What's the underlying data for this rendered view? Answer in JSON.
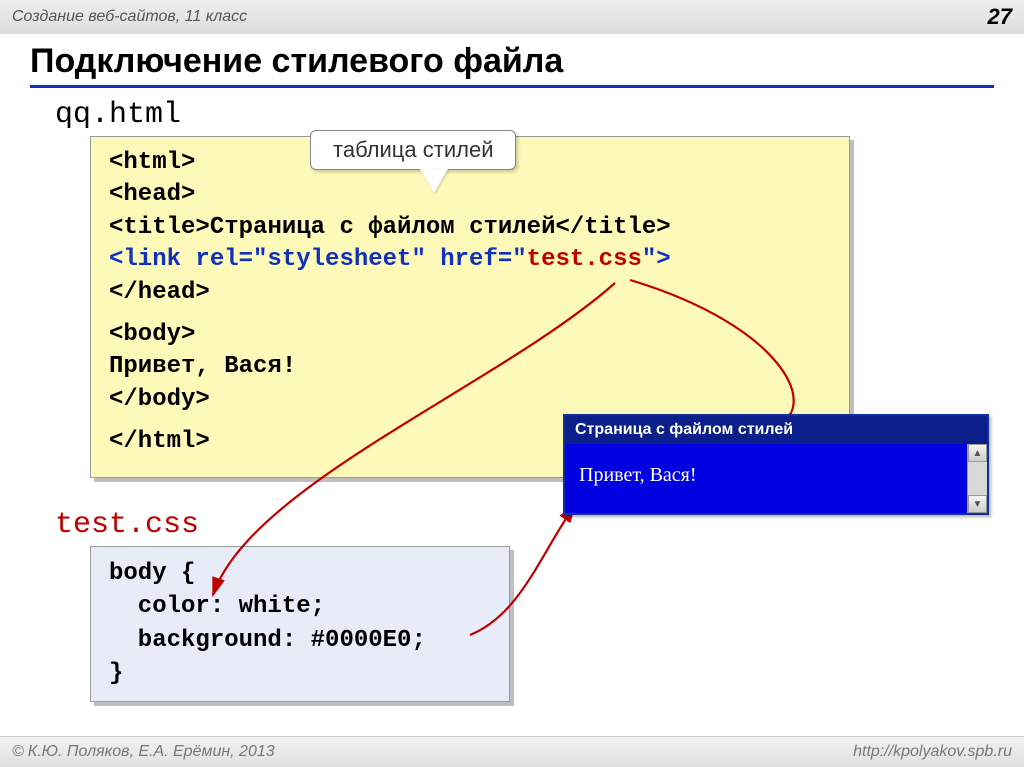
{
  "header": {
    "course": "Создание веб-сайтов, 11 класс",
    "page": "27"
  },
  "title": "Подключение стилевого файла",
  "file1": {
    "name": "qq.html",
    "callout": "таблица стилей",
    "code": {
      "l1": "<html>",
      "l2": "<head>",
      "l3a": "<title>",
      "l3b": "Страница с файлом стилей",
      "l3c": "</title>",
      "l4a": "<link rel=\"stylesheet\" href=\"",
      "l4b": "test.css",
      "l4c": "\">",
      "l5": "</head>",
      "l6": "<body>",
      "l7": "Привет, Вася!",
      "l8": "</body>",
      "l9": "</html>"
    }
  },
  "file2": {
    "name": "test.css",
    "code": "body {\n  color: white;\n  background: #0000E0;\n}"
  },
  "browser": {
    "title": "Страница с файлом стилей",
    "body": "Привет, Вася!"
  },
  "footer": {
    "copyright": "К.Ю. Поляков, Е.А. Ерёмин, 2013",
    "url": "http://kpolyakov.spb.ru"
  }
}
